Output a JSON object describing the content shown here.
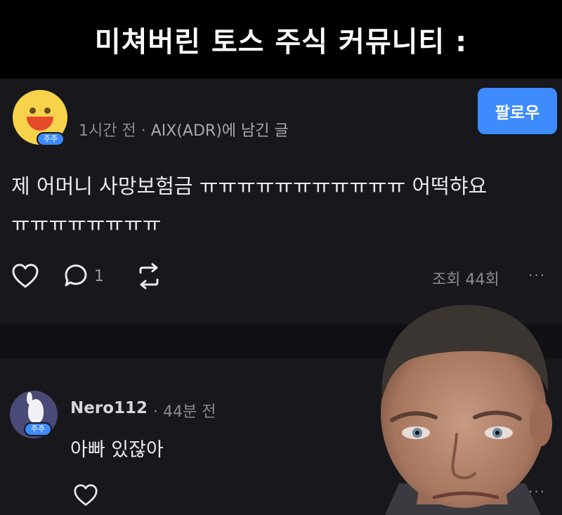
{
  "caption": "미쳐버린 토스 주식 커뮤니티 :",
  "post": {
    "avatar_badge": "주주",
    "time": "1시간 전",
    "separator": "·",
    "stock_ref": "AIX(ADR)에 남긴 글",
    "follow_label": "팔로우",
    "body_line1": "제 어머니 사망보험금 ㅠㅠㅠㅠㅠㅠㅠㅠㅠㅠㅠ 어떡햐요",
    "body_line2": "ㅠㅠㅠㅠㅠㅠㅠㅠ",
    "comment_count": "1",
    "views": "조회 44회",
    "more": "···"
  },
  "comment": {
    "avatar_badge": "주주",
    "author": "Nero112",
    "time": "· 44분 전",
    "body": "아빠 있잖아",
    "more": "···"
  },
  "icons": [
    "heart-icon",
    "comment-icon",
    "repost-icon",
    "more-icon"
  ],
  "colors": {
    "accent": "#3d8bfd",
    "background": "#17171c",
    "caption_bg": "#000000"
  }
}
